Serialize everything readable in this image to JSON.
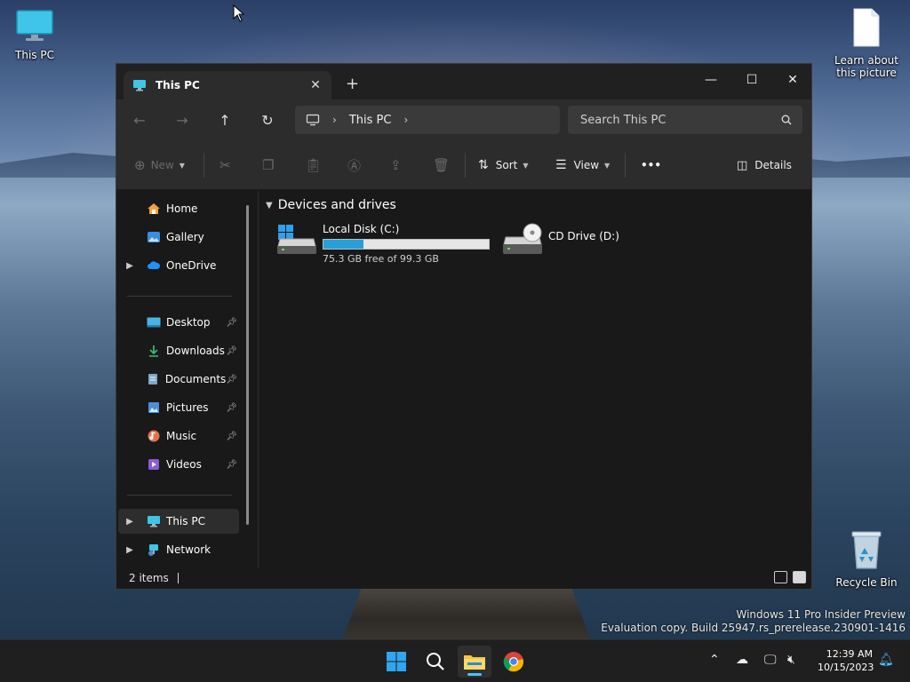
{
  "desktop": {
    "icons": [
      {
        "label": "This PC"
      },
      {
        "label": "Learn about this picture"
      },
      {
        "label": "Recycle Bin"
      }
    ],
    "watermark_line1": "Windows 11 Pro Insider Preview",
    "watermark_line2": "Evaluation copy. Build 25947.rs_prerelease.230901-1416"
  },
  "window": {
    "tab_title": "This PC",
    "new_tab_label": "+",
    "controls": {
      "minimize": "—",
      "maximize": "☐",
      "close": "✕"
    },
    "address": {
      "segments": [
        "This PC"
      ]
    },
    "search": {
      "placeholder": "Search This PC"
    },
    "commands": {
      "new_label": "New",
      "sort_label": "Sort",
      "view_label": "View",
      "more_label": "•••",
      "details_label": "Details"
    },
    "sidebar": {
      "items": [
        {
          "label": "Home"
        },
        {
          "label": "Gallery"
        },
        {
          "label": "OneDrive"
        },
        {
          "label": "Desktop"
        },
        {
          "label": "Downloads"
        },
        {
          "label": "Documents"
        },
        {
          "label": "Pictures"
        },
        {
          "label": "Music"
        },
        {
          "label": "Videos"
        },
        {
          "label": "This PC"
        },
        {
          "label": "Network"
        }
      ]
    },
    "content": {
      "group_title": "Devices and drives",
      "drives": [
        {
          "name": "Local Disk (C:)",
          "free_text": "75.3 GB free of 99.3 GB",
          "used_fraction": 0.242
        },
        {
          "name": "CD Drive (D:)"
        }
      ]
    },
    "status": {
      "items_text": "2 items"
    }
  },
  "taskbar": {
    "apps": [
      {
        "name": "start-button"
      },
      {
        "name": "search-button"
      },
      {
        "name": "file-explorer"
      },
      {
        "name": "chrome"
      }
    ],
    "clock_time": "12:39 AM",
    "clock_date": "10/15/2023"
  },
  "colors": {
    "accent": "#26a0da",
    "window_bg": "#191919",
    "toolbar_bg": "#2c2c2c",
    "taskbar_bg": "#1f1f1f"
  }
}
